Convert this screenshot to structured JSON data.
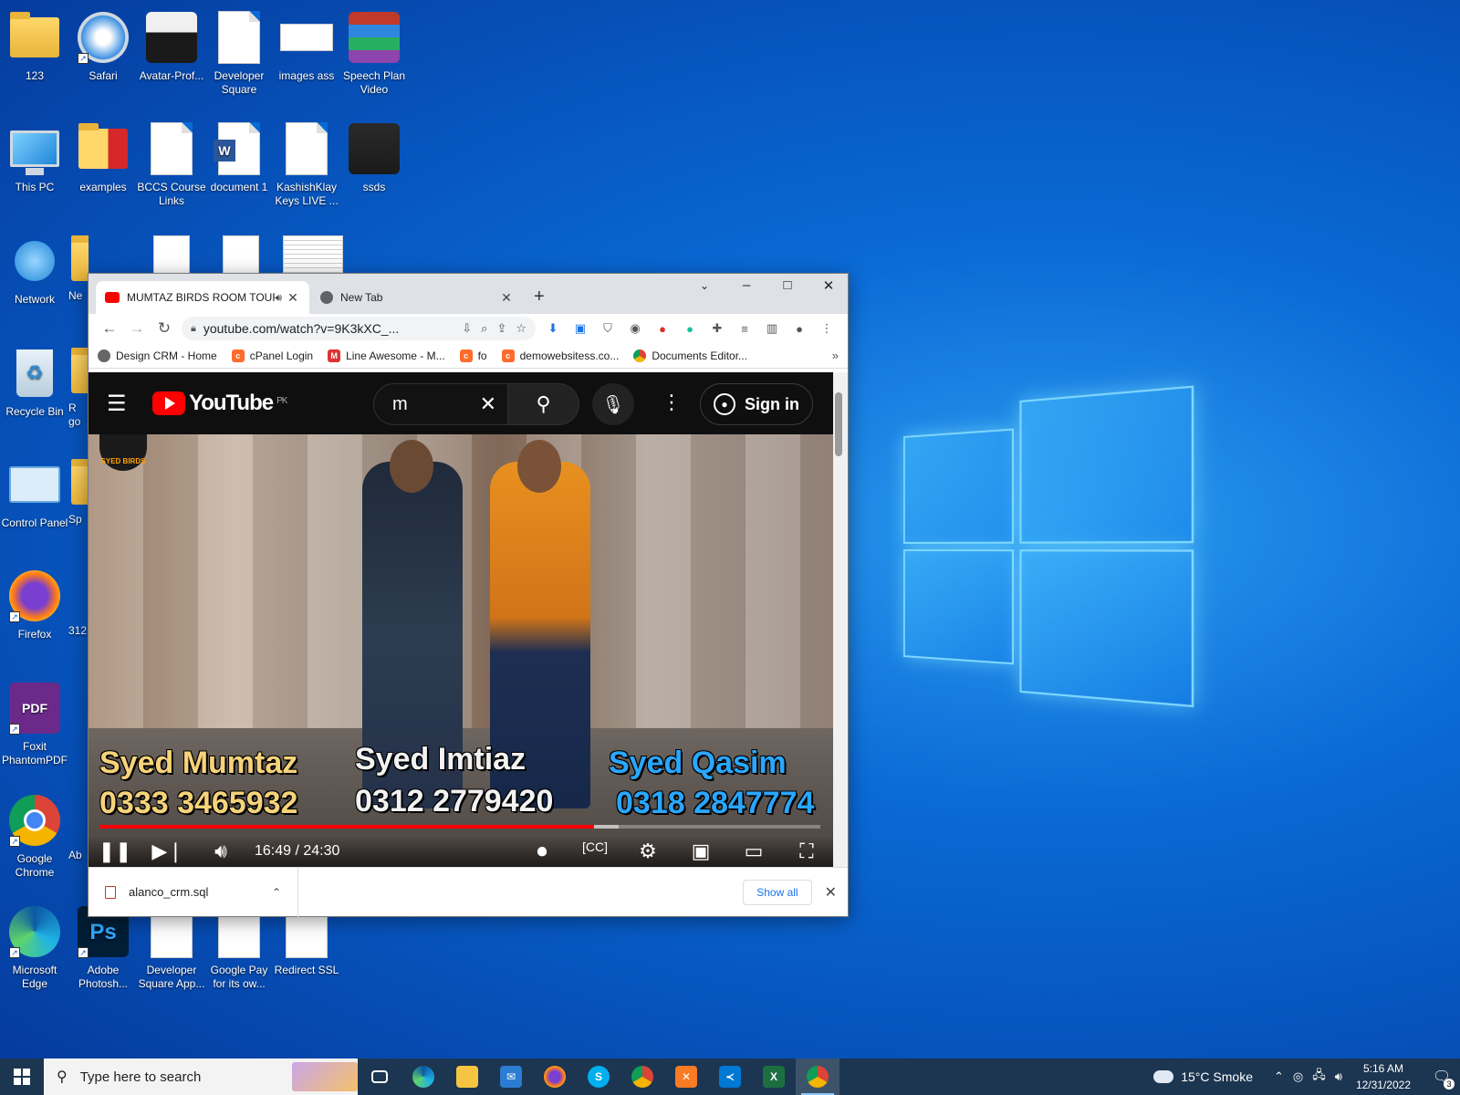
{
  "desktop": {
    "icons": [
      {
        "label": "123",
        "icon": "user-folder-icon"
      },
      {
        "label": "Safari",
        "icon": "safari-icon"
      },
      {
        "label": "Avatar-Prof...",
        "icon": "avatar-image-icon"
      },
      {
        "label": "Developer Square",
        "icon": "document-icon"
      },
      {
        "label": "images ass",
        "icon": "signature-image-icon"
      },
      {
        "label": "Speech Plan Video",
        "icon": "winrar-archive-icon"
      },
      {
        "label": "This PC",
        "icon": "computer-icon"
      },
      {
        "label": "examples",
        "icon": "pdf-folder-icon"
      },
      {
        "label": "BCCS Course Links",
        "icon": "document-icon"
      },
      {
        "label": "document 1",
        "icon": "word-document-icon"
      },
      {
        "label": "KashishKlay Keys LIVE ...",
        "icon": "document-icon"
      },
      {
        "label": "ssds",
        "icon": "photo-icon"
      },
      {
        "label": "Network",
        "icon": "network-icon"
      },
      {
        "label": "Ne",
        "icon": "folder-icon"
      },
      {
        "label": "Recycle Bin",
        "icon": "recycle-bin-icon"
      },
      {
        "label": "R go",
        "icon": "folder-icon"
      },
      {
        "label": "Control Panel",
        "icon": "control-panel-icon"
      },
      {
        "label": "Sp",
        "icon": "folder-icon"
      },
      {
        "label": "Firefox",
        "icon": "firefox-icon"
      },
      {
        "label": "312",
        "icon": "file-icon"
      },
      {
        "label": "Foxit PhantomPDF",
        "icon": "foxit-pdf-icon"
      },
      {
        "label": "Google Chrome",
        "icon": "chrome-icon"
      },
      {
        "label": "Ab",
        "icon": "file-icon"
      },
      {
        "label": "Microsoft Edge",
        "icon": "edge-icon"
      },
      {
        "label": "Adobe Photosh...",
        "icon": "photoshop-icon"
      },
      {
        "label": "Developer Square App...",
        "icon": "document-icon"
      },
      {
        "label": "Google Pay for its ow...",
        "icon": "document-icon"
      },
      {
        "label": "Redirect SSL",
        "icon": "document-icon"
      }
    ]
  },
  "browser": {
    "tabs": [
      {
        "title": "MUMTAZ BIRDS ROOM TOUR",
        "icon": "youtube-icon",
        "active": true
      },
      {
        "title": "New Tab",
        "icon": "chrome-icon",
        "active": false
      }
    ],
    "url": "youtube.com/watch?v=9K3kXC_...",
    "bookmarks": [
      {
        "label": "Design CRM - Home",
        "icon": "site-icon"
      },
      {
        "label": "cPanel Login",
        "icon": "cpanel-icon"
      },
      {
        "label": "Line Awesome - M...",
        "icon": "line-awesome-icon"
      },
      {
        "label": "fo",
        "icon": "cpanel-icon"
      },
      {
        "label": "demowebsitess.co...",
        "icon": "cpanel-icon"
      },
      {
        "label": "Documents Editor...",
        "icon": "google-icon"
      }
    ],
    "more_bookmarks": "»",
    "downloads": {
      "file": "alanco_crm.sql",
      "show_all": "Show all"
    }
  },
  "youtube": {
    "logo_text": "YouTube",
    "region": "PK",
    "search_value": "m",
    "sign_in": "Sign in",
    "channel_badge": "SYED BIRDS",
    "overlays": [
      {
        "name": "Syed Mumtaz",
        "phone": "0333 3465932"
      },
      {
        "name": "Syed Imtiaz",
        "phone": "0312 2779420"
      },
      {
        "name": "Syed Qasim",
        "phone": "0318 2847774"
      }
    ],
    "timecode": "16:49 / 24:30",
    "progress_played_fraction": 0.686,
    "progress_buffered_fraction": 0.72
  },
  "taskbar": {
    "search_placeholder": "Type here to search",
    "weather": "15°C  Smoke",
    "time": "5:16 AM",
    "date": "12/31/2022",
    "notification_count": "3"
  }
}
